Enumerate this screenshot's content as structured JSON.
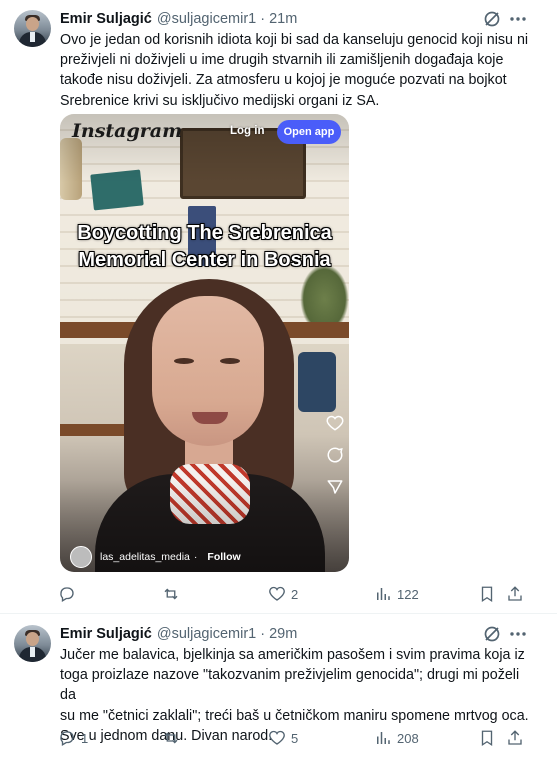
{
  "tweets": [
    {
      "author": "Emir Suljagić",
      "handle": "@suljagicemir1",
      "separator": "·",
      "time": "21m",
      "lines": [
        "Ovo je jedan od korisnih idiota koji bi sad da kanseluju genocid koji nisu ni",
        "preživjeli ni doživjeli u ime drugih stvarnih ili zamišljenih događaja koje",
        "takođe nisu doživjeli. Za atmosferu u kojoj je moguće pozvati na bojkot",
        "Srebrenice krivi su isključivo medijski organi iz SA."
      ],
      "media": {
        "platform_logo": "Instagram",
        "login_label": "Log in",
        "open_app_label": "Open app",
        "caption_line1": "Boycotting The Srebrenica",
        "caption_line2": "Memorial Center in Bosnia",
        "username": "las_adelitas_media",
        "separator": "·",
        "follow_label": "Follow"
      },
      "replies": "",
      "retweets": "",
      "likes": "2",
      "views": "122"
    },
    {
      "author": "Emir Suljagić",
      "handle": "@suljagicemir1",
      "separator": "·",
      "time": "29m",
      "lines": [
        "Jučer me balavica, bjelkinja sa američkim pasošem i svim pravima koja iz",
        "toga proizlaze nazove \"takozvanim preživjelim genocida\"; drugi mi poželi da",
        "su me \"četnici zaklali\"; treći baš u četničkom maniru spomene mrtvog oca.",
        "Sve u jednom danu. Divan narod."
      ],
      "replies": "1",
      "retweets": "",
      "likes": "5",
      "views": "208"
    }
  ],
  "icons": {
    "reply": "reply-icon",
    "retweet": "retweet-icon",
    "like": "heart-icon",
    "views": "views-chart-icon",
    "bookmark": "bookmark-icon",
    "share": "share-icon",
    "grok": "grok-icon",
    "more": "more-icon"
  },
  "colors": {
    "text": "#0f1419",
    "muted": "#536471",
    "divider": "#eff3f4",
    "open_app": "#4a5df9"
  }
}
